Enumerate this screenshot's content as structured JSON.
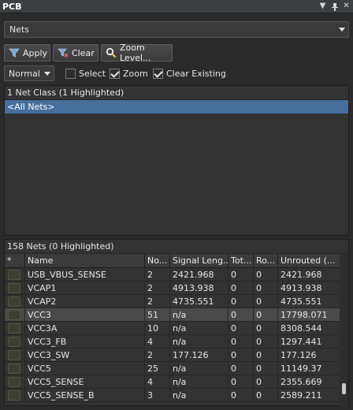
{
  "panel": {
    "title": "PCB",
    "controls": {
      "menu": "▼",
      "pin": "⊓",
      "close": "✕"
    }
  },
  "mode_select": {
    "value": "Nets"
  },
  "toolbar": {
    "apply_label": "Apply",
    "clear_label": "Clear",
    "zoom_label": "Zoom Level..."
  },
  "options": {
    "mode": "Normal",
    "select_label": "Select",
    "select_checked": false,
    "zoom_label": "Zoom",
    "zoom_checked": true,
    "clear_existing_label": "Clear Existing",
    "clear_existing_checked": true
  },
  "net_class": {
    "header": "1 Net Class (1 Highlighted)",
    "items": [
      "<All Nets>"
    ]
  },
  "nets": {
    "header": "158 Nets (0 Highlighted)",
    "columns": [
      "*",
      "Name",
      "No...",
      "Signal Leng...",
      "Tot...",
      "Ro...",
      "Unrouted (..."
    ],
    "rows": [
      {
        "name": "USB_VBUS_SENSE",
        "nodes": "2",
        "signal_length": "2421.968",
        "total": "0",
        "routed": "0",
        "unrouted": "2421.968"
      },
      {
        "name": "VCAP1",
        "nodes": "2",
        "signal_length": "4913.938",
        "total": "0",
        "routed": "0",
        "unrouted": "4913.938"
      },
      {
        "name": "VCAP2",
        "nodes": "2",
        "signal_length": "4735.551",
        "total": "0",
        "routed": "0",
        "unrouted": "4735.551"
      },
      {
        "name": "VCC3",
        "nodes": "51",
        "signal_length": "n/a",
        "total": "0",
        "routed": "0",
        "unrouted": "17798.071"
      },
      {
        "name": "VCC3A",
        "nodes": "10",
        "signal_length": "n/a",
        "total": "0",
        "routed": "0",
        "unrouted": "8308.544"
      },
      {
        "name": "VCC3_FB",
        "nodes": "4",
        "signal_length": "n/a",
        "total": "0",
        "routed": "0",
        "unrouted": "1297.441"
      },
      {
        "name": "VCC3_SW",
        "nodes": "2",
        "signal_length": "177.126",
        "total": "0",
        "routed": "0",
        "unrouted": "177.126"
      },
      {
        "name": "VCC5",
        "nodes": "25",
        "signal_length": "n/a",
        "total": "0",
        "routed": "0",
        "unrouted": "11149.37"
      },
      {
        "name": "VCC5_SENSE",
        "nodes": "4",
        "signal_length": "n/a",
        "total": "0",
        "routed": "0",
        "unrouted": "2355.669"
      },
      {
        "name": "VCC5_SENSE_B",
        "nodes": "3",
        "signal_length": "n/a",
        "total": "0",
        "routed": "0",
        "unrouted": "2589.211"
      }
    ],
    "selected_row": "VCC3"
  },
  "colors": {
    "panel_bg": "#2b2b2b",
    "highlight": "#476f9e",
    "selected_row": "#4a4a4a"
  }
}
